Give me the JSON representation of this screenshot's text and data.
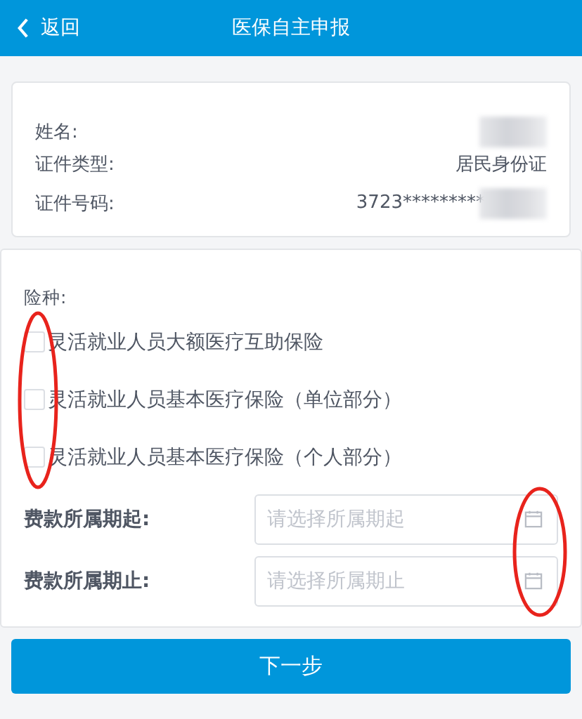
{
  "header": {
    "back_label": "返回",
    "title": "医保自主申报"
  },
  "person": {
    "rows": [
      {
        "label": "姓名:",
        "value": "",
        "redacted": true
      },
      {
        "label": "证件类型:",
        "value": "居民身份证",
        "redacted": false
      },
      {
        "label": "证件号码:",
        "value": "3723*********",
        "redacted": true
      }
    ]
  },
  "insurance": {
    "label": "险种:",
    "options": [
      {
        "label": "灵活就业人员大额医疗互助保险",
        "checked": false
      },
      {
        "label": "灵活就业人员基本医疗保险（单位部分）",
        "checked": false
      },
      {
        "label": "灵活就业人员基本医疗保险（个人部分）",
        "checked": false
      }
    ],
    "checkboxes_circled": true
  },
  "period": {
    "fields": [
      {
        "label": "费款所属期起:",
        "placeholder": "请选择所属期起"
      },
      {
        "label": "费款所属期止:",
        "placeholder": "请选择所属期止"
      }
    ],
    "icons_circled": true
  },
  "next_button": "下一步"
}
